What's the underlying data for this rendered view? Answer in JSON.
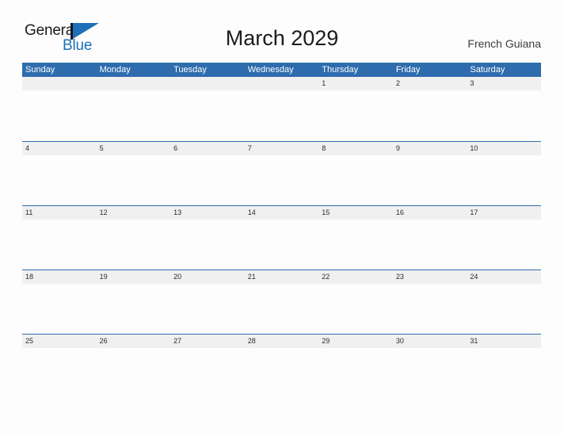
{
  "brand": {
    "name_part_1": "General",
    "name_part_2": "Blue",
    "flag_icon": "triangle-flag-icon",
    "accent_color": "#1d70b8"
  },
  "header": {
    "title": "March 2029",
    "locale": "French Guiana"
  },
  "calendar": {
    "header_color": "#2e6cad",
    "band_color": "#f0f0f0",
    "weekdays": [
      "Sunday",
      "Monday",
      "Tuesday",
      "Wednesday",
      "Thursday",
      "Friday",
      "Saturday"
    ],
    "weeks": [
      [
        "",
        "",
        "",
        "",
        "1",
        "2",
        "3"
      ],
      [
        "4",
        "5",
        "6",
        "7",
        "8",
        "9",
        "10"
      ],
      [
        "11",
        "12",
        "13",
        "14",
        "15",
        "16",
        "17"
      ],
      [
        "18",
        "19",
        "20",
        "21",
        "22",
        "23",
        "24"
      ],
      [
        "25",
        "26",
        "27",
        "28",
        "29",
        "30",
        "31"
      ]
    ]
  }
}
